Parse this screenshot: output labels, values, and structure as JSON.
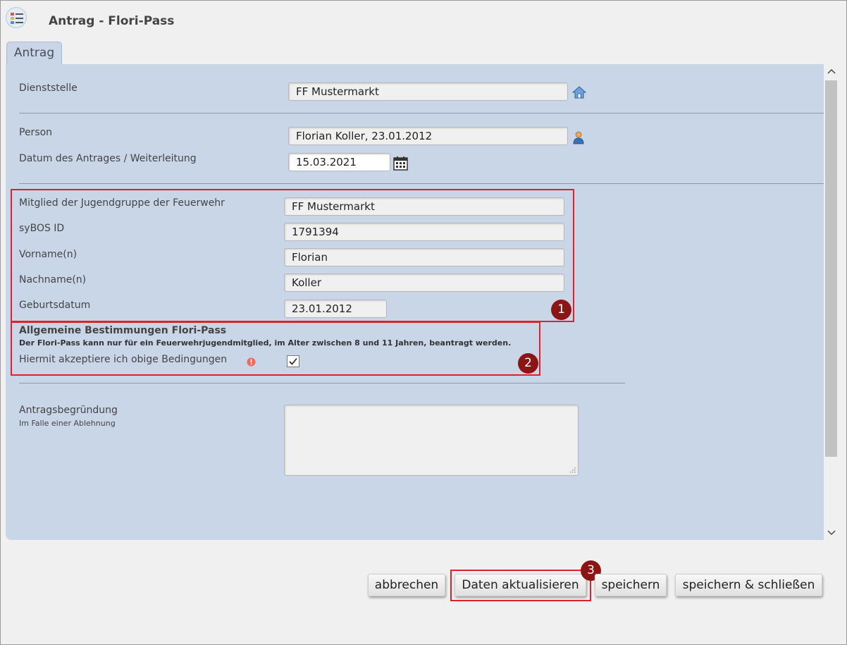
{
  "window": {
    "title": "Antrag - Flori-Pass",
    "app_icon": "form-list-icon"
  },
  "tabs": [
    {
      "label": "Antrag",
      "active": true
    }
  ],
  "form": {
    "dienststelle": {
      "label": "Dienststelle",
      "value": "FF Mustermarkt",
      "icon": "home-icon"
    },
    "person": {
      "label": "Person",
      "value": "Florian Koller, 23.01.2012",
      "icon": "person-icon"
    },
    "datum": {
      "label": "Datum des Antrages / Weiterleitung",
      "value": "15.03.2021",
      "icon": "calendar-icon"
    },
    "mitglied": {
      "label": "Mitglied der Jugendgruppe der Feuerwehr",
      "value": "FF Mustermarkt"
    },
    "sybos_id": {
      "label": "syBOS ID",
      "value": "1791394"
    },
    "vorname": {
      "label": "Vorname(n)",
      "value": "Florian"
    },
    "nachname": {
      "label": "Nachname(n)",
      "value": "Koller"
    },
    "geburtsdatum": {
      "label": "Geburtsdatum",
      "value": "23.01.2012"
    },
    "bestimmungen": {
      "heading": "Allgemeine Bestimmungen Flori-Pass",
      "text": "Der Flori-Pass kann nur für ein Feuerwehrjugendmitglied, im Alter zwischen 8 und 11 Jahren, beantragt werden.",
      "accept_label": "Hiermit akzeptiere ich obige Bedingungen",
      "accepted": true,
      "warning_icon": "warning-icon"
    },
    "begruendung": {
      "label": "Antragsbegründung",
      "sublabel": "Im Falle einer Ablehnung",
      "value": ""
    }
  },
  "markers": [
    "1",
    "2",
    "3"
  ],
  "buttons": {
    "cancel": "abbrechen",
    "refresh": "Daten aktualisieren",
    "save": "speichern",
    "save_close": "speichern & schließen"
  },
  "colors": {
    "panel": "#c9d6e8",
    "highlight": "#e0202a",
    "marker": "#8b1414"
  }
}
